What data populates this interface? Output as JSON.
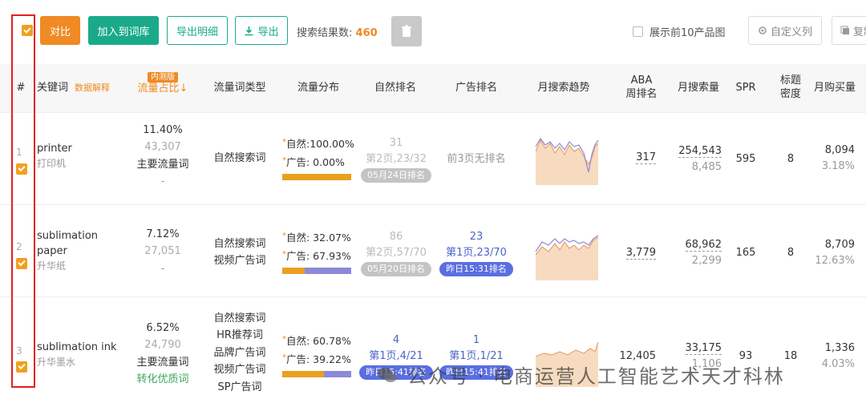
{
  "toolbar": {
    "compare_label": "对比",
    "add_to_lexicon_label": "加入到词库",
    "export_detail_label": "导出明细",
    "export_label": "导出",
    "result_count_label": "搜索结果数:",
    "result_count": "460",
    "show_top10_label": "展示前10产品图",
    "custom_columns_label": "自定义列",
    "copy_label": "复制"
  },
  "header": {
    "hash": "#",
    "keyword": "关键词",
    "data_explain": "数据解释",
    "internal_tag": "内测版",
    "traffic_share": "流量占比↓",
    "traffic_type": "流量词类型",
    "traffic_distribution": "流量分布",
    "natural_rank": "自然排名",
    "ad_rank": "广告排名",
    "monthly_trend": "月搜索趋势",
    "aba_rank_line1": "ABA",
    "aba_rank_line2": "周排名",
    "monthly_search": "月搜索量",
    "spr": "SPR",
    "title_density_line1": "标题",
    "title_density_line2": "密度",
    "monthly_purchase": "月购买量"
  },
  "rows": [
    {
      "index": "1",
      "keyword_en": "printer",
      "keyword_cn": "打印机",
      "share_pct": "11.40%",
      "share_num": "43,307",
      "share_tag": "主要流量词",
      "share_extra": "-",
      "types": [
        "自然搜索词"
      ],
      "dist_natural": "自然:100.00%",
      "dist_ad": "广告:   0.00%",
      "dist_natural_ratio": 1.0,
      "natural_rank_top": "31",
      "natural_rank_detail": "第2页,23/32",
      "natural_rank_pill": "05月24日排名",
      "ad_rank_text": "前3页无排名",
      "aba_rank": "317",
      "monthly_search": "254,543",
      "monthly_search_sub": "8,485",
      "spr": "595",
      "title_density": "8",
      "monthly_purchase": "8,094",
      "purchase_rate": "3.18%"
    },
    {
      "index": "2",
      "keyword_en": "sublimation paper",
      "keyword_cn": "升华纸",
      "share_pct": "7.12%",
      "share_num": "27,051",
      "share_extra": "-",
      "types": [
        "自然搜索词",
        "视频广告词"
      ],
      "dist_natural": "自然:  32.07%",
      "dist_ad": "广告:  67.93%",
      "dist_natural_ratio": 0.3207,
      "natural_rank_top": "86",
      "natural_rank_detail": "第2页,57/70",
      "natural_rank_pill": "05月20日排名",
      "ad_rank_top": "23",
      "ad_rank_detail": "第1页,23/70",
      "ad_rank_pill": "昨日15:31排名",
      "aba_rank": "3,779",
      "monthly_search": "68,962",
      "monthly_search_sub": "2,299",
      "spr": "165",
      "title_density": "8",
      "monthly_purchase": "8,709",
      "purchase_rate": "12.63%"
    },
    {
      "index": "3",
      "keyword_en": "sublimation ink",
      "keyword_cn": "升华墨水",
      "share_pct": "6.52%",
      "share_num": "24,790",
      "share_tag": "主要流量词",
      "share_green": "转化优质词",
      "types": [
        "自然搜索词",
        "HR推荐词",
        "品牌广告词",
        "视频广告词",
        "SP广告词"
      ],
      "dist_natural": "自然:  60.78%",
      "dist_ad": "广告:  39.22%",
      "dist_natural_ratio": 0.6078,
      "natural_rank_top": "4",
      "natural_rank_detail": "第1页,4/21",
      "natural_rank_pill": "昨日15:41排名",
      "ad_rank_top": "1",
      "ad_rank_detail": "第1页,1/21",
      "ad_rank_pill": "昨日15:41排名",
      "aba_rank": "12,405",
      "monthly_search": "33,175",
      "monthly_search_sub": "1,106",
      "spr": "93",
      "title_density": "18",
      "monthly_purchase": "1,336",
      "purchase_rate": "4.03%"
    }
  ],
  "watermark": "公众号 · 电商运营人工智能艺术天才科林",
  "colors": {
    "accent_orange": "#f08a24",
    "accent_green": "#1aaa8a",
    "ad_blue": "#8c8ad8",
    "natural_gold": "#e8a020",
    "highlight_red": "#e02020"
  }
}
